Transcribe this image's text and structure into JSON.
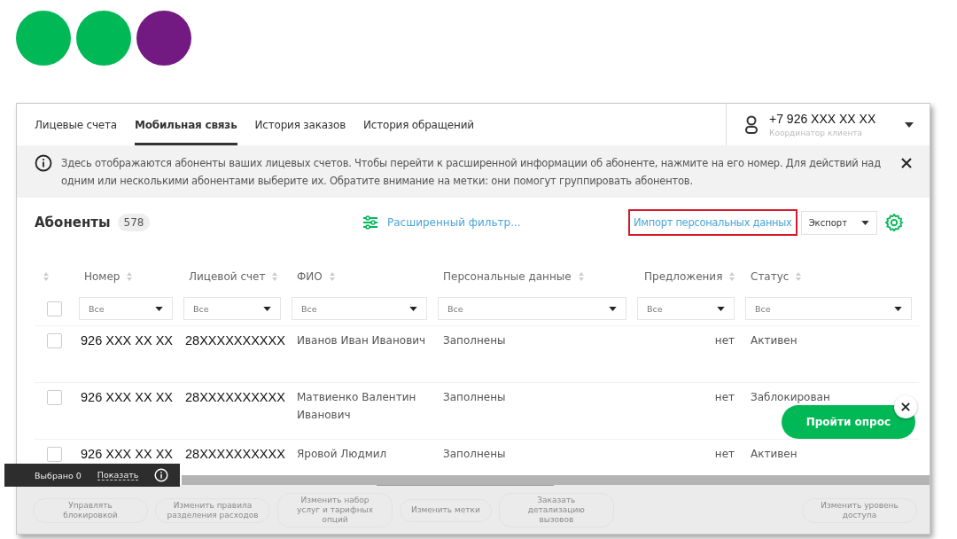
{
  "tabs": [
    {
      "label": "Лицевые счета",
      "selected": false
    },
    {
      "label": "Мобильная связь",
      "selected": true
    },
    {
      "label": "История заказов",
      "selected": false
    },
    {
      "label": "История обращений",
      "selected": false
    }
  ],
  "account": {
    "phone": "+7 926 XXX XX XX",
    "role": "Координатор клиента"
  },
  "notice": {
    "text": "Здесь отображаются абоненты ваших лицевых счетов. Чтобы перейти к расширенной информации об абоненте, нажмите на его номер. Для действий над одним или несколькими абонентами выберите их. Обратите внимание на метки: они помогут группировать абонентов."
  },
  "subscribers": {
    "title": "Абоненты",
    "count": "578"
  },
  "filter_link": "Расширенный фильтр...",
  "import_link": {
    "label": "Импорт персональных данных",
    "highlighted": true
  },
  "export": {
    "label": "Экспорт"
  },
  "table": {
    "select_all_checked": false,
    "columns": [
      {
        "label": "Номер",
        "filter": "Все"
      },
      {
        "label": "Лицевой счет",
        "filter": "Все"
      },
      {
        "label": "ФИО",
        "filter": "Все"
      },
      {
        "label": "Персональные данные",
        "filter": "Все"
      },
      {
        "label": "Предложения",
        "filter": "Все"
      },
      {
        "label": "Статус",
        "filter": "Все"
      }
    ],
    "rows": [
      {
        "checked": false,
        "cells": [
          "926 XXX XX XX",
          "28XXXXXXXXXX",
          "Иванов Иван Иванович",
          "Заполнены",
          "нет",
          "Активен"
        ]
      },
      {
        "checked": false,
        "cells": [
          "926 XXX XX XX",
          "28XXXXXXXXXX",
          "Матвиенко Валентин Иванович",
          "Заполнены",
          "нет",
          "Заблокирован"
        ]
      },
      {
        "checked": false,
        "cells": [
          "926 XXX XX XX",
          "28XXXXXXXXXX",
          "Яровой Людмил",
          "Заполнены",
          "нет",
          "Активен"
        ]
      }
    ]
  },
  "selection_bar": {
    "count_label": "Выбрано 0",
    "show_label": "Показать"
  },
  "survey": {
    "label": "Пройти опрос"
  },
  "actions": [
    {
      "label": "Управлять блокировкой",
      "disabled": true
    },
    {
      "label": "Изменить правила разделения расходов",
      "disabled": true
    },
    {
      "label": "Изменить набор услуг и тарифных опций",
      "disabled": true
    },
    {
      "label": "Изменить метки",
      "disabled": true
    },
    {
      "label": "Заказать детализацию вызовов",
      "disabled": true
    },
    {
      "label": "Изменить уровень доступа",
      "disabled": true
    }
  ]
}
